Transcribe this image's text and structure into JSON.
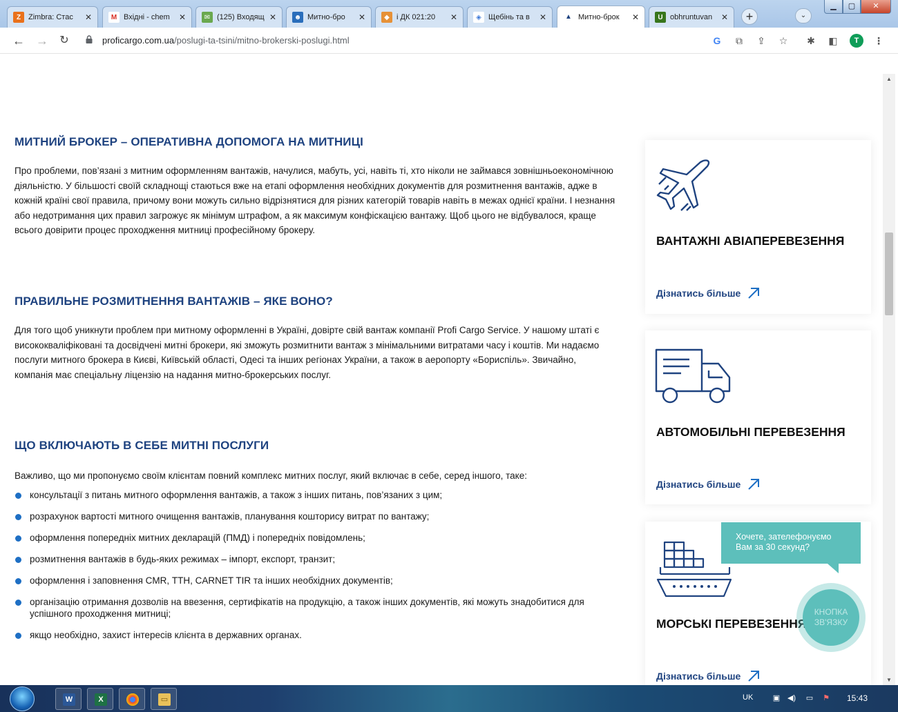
{
  "browser": {
    "tabs": [
      {
        "title": "Zimbra: Стас",
        "icon": "zimbra-icon",
        "color": "#e9711c",
        "glyph": "Z"
      },
      {
        "title": "Вхідні - chem",
        "icon": "gmail-icon",
        "color": "#d93025",
        "glyph": "M"
      },
      {
        "title": "(125) Входящ",
        "icon": "mail-envelope-icon",
        "color": "#6aa84f",
        "glyph": "✉"
      },
      {
        "title": "Митно-бро",
        "icon": "people-icon",
        "color": "#2a6ebb",
        "glyph": "👥"
      },
      {
        "title": "і ДК 021:20",
        "icon": "dk-icon",
        "color": "#e69138",
        "glyph": "◆"
      },
      {
        "title": "Щебінь та в",
        "icon": "diamond-icon",
        "color": "#3c78d8",
        "glyph": "◈"
      },
      {
        "title": "Митно-брок",
        "icon": "ship-icon",
        "color": "#1f4380",
        "glyph": "⛴"
      },
      {
        "title": "obhruntuvan",
        "icon": "u-icon",
        "color": "#38761d",
        "glyph": "U"
      }
    ],
    "new_tab": "+",
    "address": {
      "host": "proficargo.com.ua",
      "path": "/poslugi-ta-tsini/mitno-brokerski-poslugi.html"
    },
    "profile_initial": "T"
  },
  "content": {
    "sections": [
      {
        "heading": "МИТНИЙ БРОКЕР – ОПЕРАТИВНА ДОПОМОГА НА МИТНИЦІ",
        "text": "Про проблеми, пов’язані з митним оформленням вантажів, начулися, мабуть, усі, навіть ті, хто ніколи не займався зовнішньоекономічною діяльністю. У більшості своїй складнощі стаються вже на етапі оформлення необхідних документів для розмитнення вантажів, адже в кожній країні свої правила, причому вони можуть сильно відрізнятися для різних категорій товарів навіть в межах однієї країни. І незнання або недотримання цих правил загрожує як мінімум штрафом, а як максимум конфіскацією вантажу. Щоб цього не відбувалося, краще всього довірити процес проходження митниці професійному брокеру."
      },
      {
        "heading": "ПРАВИЛЬНЕ РОЗМИТНЕННЯ ВАНТАЖІВ – ЯКЕ ВОНО?",
        "text": "Для того щоб уникнути проблем при митному оформленні в Україні, довірте свій вантаж компанії Profi Cargo Service. У нашому штаті є висококваліфіковані та досвідчені митні брокери, які зможуть розмитнити вантаж з мінімальними витратами часу і коштів. Ми надаємо послуги митного брокера в Києві, Київській області, Одесі та інших регіонах України, а також в аеропорту «Бориспіль». Звичайно, компанія має спеціальну ліцензію на надання митно-брокерських послуг."
      },
      {
        "heading": "ЩО ВКЛЮЧАЮТЬ В СЕБЕ МИТНІ ПОСЛУГИ",
        "text": "Важливо, що ми пропонуємо своїм клієнтам повний комплекс митних послуг, який включає в себе, серед іншого, таке:"
      }
    ],
    "services": [
      "консультації з питань митного оформлення вантажів, а також з інших питань, пов’язаних з цим;",
      "розрахунок вартості митного очищення вантажів, планування кошторису витрат по вантажу;",
      "оформлення попередніх митних декларацій (ПМД) і попередніх повідомлень;",
      "розмитнення вантажів в будь-яких режимах – імпорт, експорт, транзит;",
      "оформлення і заповнення CMR, ТТН, CARNET TIR та інших необхідних документів;",
      "організацію отримання дозволів на ввезення, сертифікатів на продукцію, а також інших документів, які можуть знадобитися для успішного проходження митниці;",
      "якщо необхідно, захист інтересів клієнта в державних органах."
    ]
  },
  "sidebar": {
    "cards": [
      {
        "title": "ВАНТАЖНІ АВІАПЕРЕВЕЗЕННЯ",
        "link": "Дізнатись більше",
        "icon": "airplane-icon"
      },
      {
        "title": "АВТОМОБІЛЬНІ ПЕРЕВЕЗЕННЯ",
        "link": "Дізнатись більше",
        "icon": "truck-icon"
      },
      {
        "title": "МОРСЬКІ ПЕРЕВЕЗЕННЯ",
        "link": "Дізнатись більше",
        "icon": "cargo-ship-icon"
      }
    ]
  },
  "callback": {
    "bubble_line1": "Хочете, зателефонуємо",
    "bubble_line2": "Вам за 30 секунд?",
    "button_line1": "КНОПКА",
    "button_line2": "ЗВ'ЯЗКУ"
  },
  "taskbar": {
    "lang": "UK",
    "clock": "15:43"
  },
  "colors": {
    "heading": "#1f4380",
    "accent": "#1e6fc4",
    "callback": "#5dbfbb"
  }
}
